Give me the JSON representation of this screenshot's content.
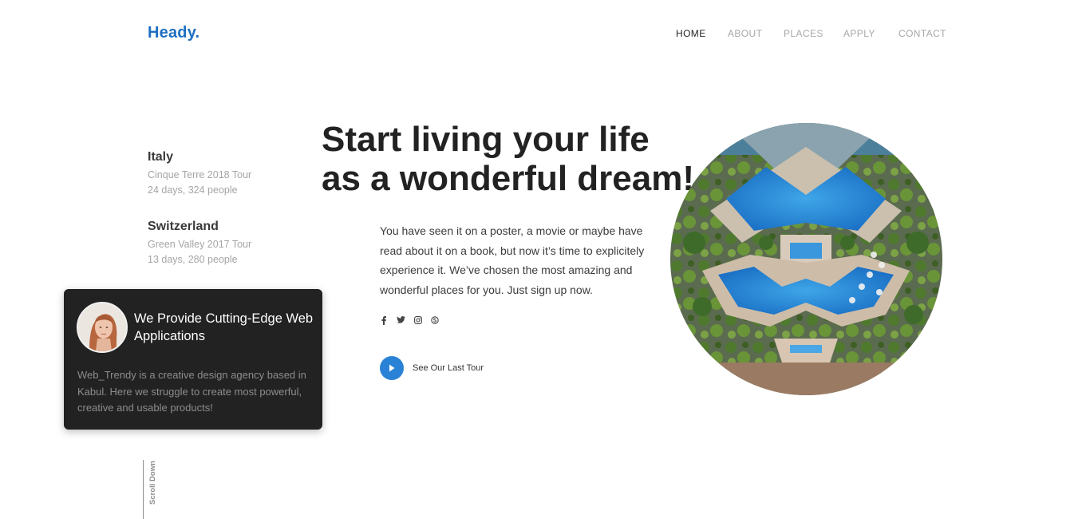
{
  "brand": {
    "logo": "Heady."
  },
  "nav": {
    "items": [
      "HOME",
      "ABOUT",
      "PLACES",
      "APPLY",
      "CONTACT"
    ],
    "active": "HOME"
  },
  "tours": [
    {
      "name": "Italy",
      "tour": "Cinque Terre 2018 Tour",
      "details": "24 days, 324 people"
    },
    {
      "name": "Switzerland",
      "tour": "Green Valley 2017 Tour",
      "details": "13 days, 280 people"
    }
  ],
  "card": {
    "title": "We Provide Cutting-Edge Web Applications",
    "text": "Web_Trendy is a creative design agency based in Kabul. Here we struggle to create most powerful, creative and usable products!"
  },
  "scroll": {
    "label": "Scroll Down"
  },
  "hero": {
    "headline_line1": "Start living your life",
    "headline_line2": "as a wonderful dream!",
    "paragraph": "You have seen it on a poster, a movie or maybe have read about it on a book, but now it’s time to explicitely experience it. We’ve chosen the most amazing and wonderful places for you. Just sign up now."
  },
  "social": {
    "icons": [
      {
        "name": "facebook-icon",
        "glyph": "f"
      },
      {
        "name": "twitter-icon",
        "glyph": "t"
      },
      {
        "name": "instagram-icon",
        "glyph": "◎"
      },
      {
        "name": "skype-icon",
        "glyph": "s"
      }
    ]
  },
  "cta": {
    "label": "See Our Last Tour"
  },
  "colors": {
    "brand": "#1f6fc0",
    "accent": "#2a82d6",
    "card_bg": "#222222",
    "muted": "#a5a5a5"
  }
}
